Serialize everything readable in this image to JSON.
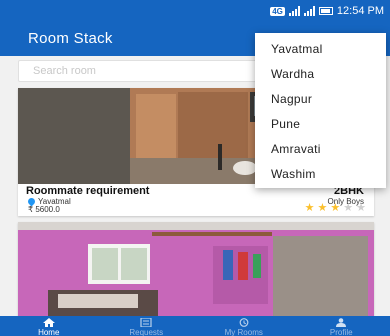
{
  "status_bar": {
    "network": "4G",
    "time": "12:54 PM"
  },
  "app_bar": {
    "title": "Room Stack"
  },
  "search": {
    "placeholder": "Search room"
  },
  "city_menu": {
    "items": [
      "Yavatmal",
      "Wardha",
      "Nagpur",
      "Pune",
      "Amravati",
      "Washim"
    ]
  },
  "listings": [
    {
      "title": "Roommate requirement",
      "bhk": "2BHK",
      "location": "Yavatmal",
      "gender": "Only Boys",
      "price": "₹ 5600.0",
      "rating": 3,
      "rating_max": 5
    }
  ],
  "bottom_nav": {
    "items": [
      {
        "label": "Home",
        "icon": "home-icon",
        "active": true
      },
      {
        "label": "Requests",
        "icon": "list-icon",
        "active": false
      },
      {
        "label": "My Rooms",
        "icon": "history-icon",
        "active": false
      },
      {
        "label": "Profile",
        "icon": "person-icon",
        "active": false
      }
    ]
  },
  "colors": {
    "primary": "#1565c0",
    "star": "#fbc02d",
    "pin": "#2196f3"
  }
}
